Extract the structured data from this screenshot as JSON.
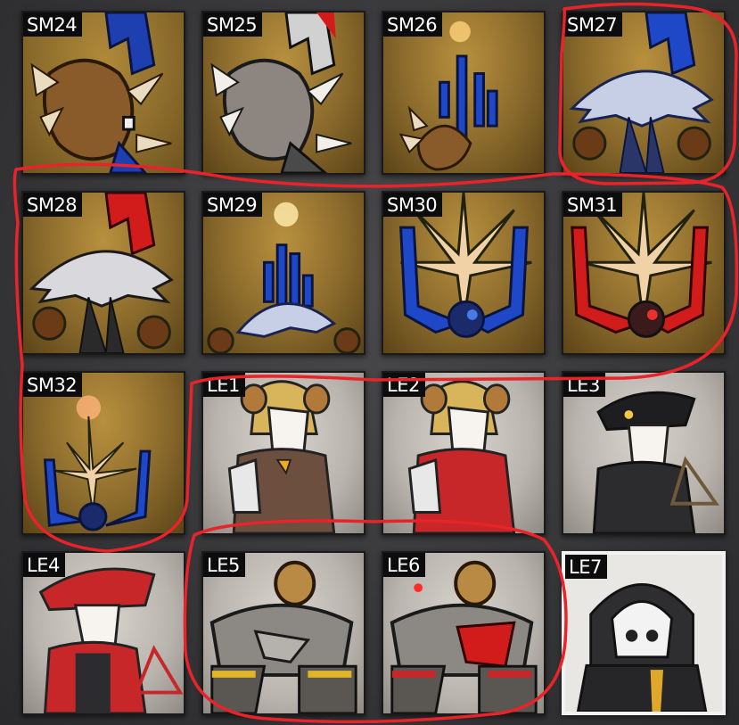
{
  "tiles": [
    {
      "id": "SM24",
      "kind": "sm"
    },
    {
      "id": "SM25",
      "kind": "sm"
    },
    {
      "id": "SM26",
      "kind": "sm"
    },
    {
      "id": "SM27",
      "kind": "sm"
    },
    {
      "id": "SM28",
      "kind": "sm"
    },
    {
      "id": "SM29",
      "kind": "sm"
    },
    {
      "id": "SM30",
      "kind": "sm"
    },
    {
      "id": "SM31",
      "kind": "sm"
    },
    {
      "id": "SM32",
      "kind": "sm"
    },
    {
      "id": "LE1",
      "kind": "le"
    },
    {
      "id": "LE2",
      "kind": "le"
    },
    {
      "id": "LE3",
      "kind": "le"
    },
    {
      "id": "LE4",
      "kind": "le"
    },
    {
      "id": "LE5",
      "kind": "le"
    },
    {
      "id": "LE6",
      "kind": "le"
    },
    {
      "id": "LE7",
      "kind": "le"
    }
  ],
  "colors": {
    "annotation": "#e8232a",
    "label_bg": "#0c0c0c",
    "label_text": "#ffffff",
    "blue_armor": "#1f48c9",
    "red_armor": "#d21c1c"
  }
}
